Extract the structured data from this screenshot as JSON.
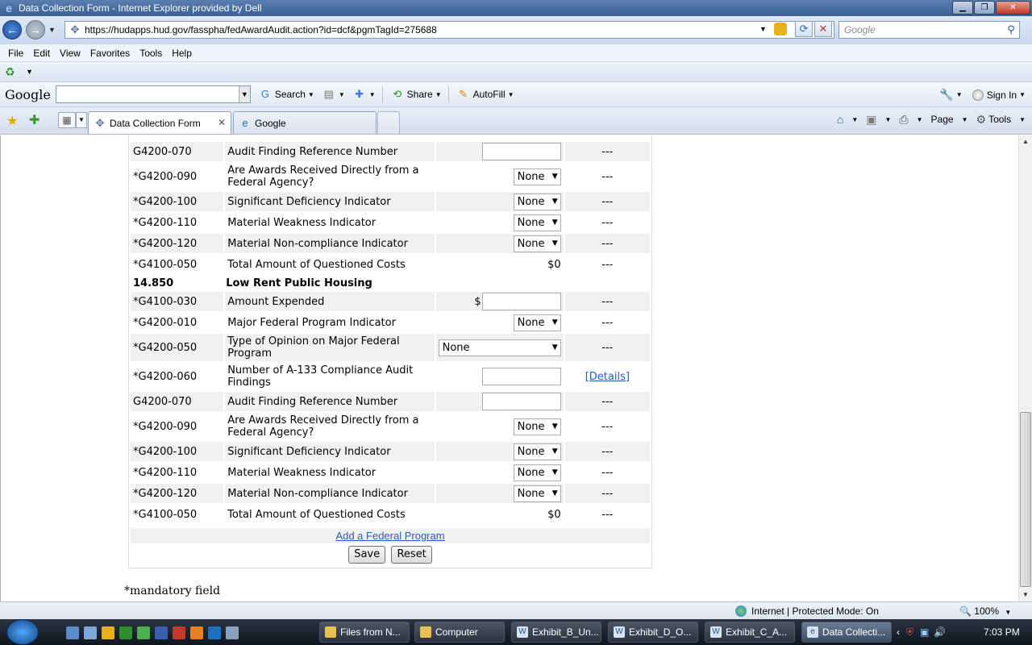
{
  "window": {
    "title": "Data Collection Form - Internet Explorer provided by Dell"
  },
  "address": {
    "url": "https://hudapps.hud.gov/fasspha/fedAwardAudit.action?id=dcf&pgmTagId=275688",
    "search_placeholder": "Google"
  },
  "menu": [
    "File",
    "Edit",
    "View",
    "Favorites",
    "Tools",
    "Help"
  ],
  "google_toolbar": {
    "logo": "Google",
    "search_label": "Search",
    "share_label": "Share",
    "autofill_label": "AutoFill",
    "signin_label": "Sign In"
  },
  "tabs": [
    {
      "label": "Data Collection Form",
      "active": true
    },
    {
      "label": "Google",
      "active": false
    }
  ],
  "command_bar": {
    "page": "Page",
    "tools": "Tools"
  },
  "form": {
    "rows_a": [
      {
        "code": "G4200-070",
        "label": "Audit Finding Reference Number",
        "control": "text",
        "status": "---"
      },
      {
        "code": "*G4200-090",
        "label": "Are Awards Received Directly from a Federal Agency?",
        "control": "select",
        "value": "None",
        "status": "---"
      },
      {
        "code": "*G4200-100",
        "label": "Significant Deficiency Indicator",
        "control": "select",
        "value": "None",
        "status": "---"
      },
      {
        "code": "*G4200-110",
        "label": "Material Weakness Indicator",
        "control": "select",
        "value": "None",
        "status": "---"
      },
      {
        "code": "*G4200-120",
        "label": "Material Non-compliance Indicator",
        "control": "select",
        "value": "None",
        "status": "---"
      },
      {
        "code": "*G4100-050",
        "label": "Total Amount of Questioned Costs",
        "control": "amount",
        "value": "$0",
        "status": "---"
      }
    ],
    "section": {
      "code": "14.850",
      "title": "Low Rent Public Housing"
    },
    "rows_b": [
      {
        "code": "*G4100-030",
        "label": "Amount Expended",
        "control": "money",
        "currency": "$",
        "status": "---"
      },
      {
        "code": "*G4200-010",
        "label": "Major Federal Program Indicator",
        "control": "select",
        "value": "None",
        "status": "---"
      },
      {
        "code": "*G4200-050",
        "label": "Type of Opinion on Major Federal Program",
        "control": "select-wide",
        "value": "None",
        "status": "---"
      },
      {
        "code": "*G4200-060",
        "label": "Number of A-133 Compliance Audit Findings",
        "control": "text",
        "status": "[Details]"
      },
      {
        "code": "G4200-070",
        "label": "Audit Finding Reference Number",
        "control": "text",
        "status": "---"
      },
      {
        "code": "*G4200-090",
        "label": "Are Awards Received Directly from a Federal Agency?",
        "control": "select",
        "value": "None",
        "status": "---"
      },
      {
        "code": "*G4200-100",
        "label": "Significant Deficiency Indicator",
        "control": "select",
        "value": "None",
        "status": "---"
      },
      {
        "code": "*G4200-110",
        "label": "Material Weakness Indicator",
        "control": "select",
        "value": "None",
        "status": "---"
      },
      {
        "code": "*G4200-120",
        "label": "Material Non-compliance Indicator",
        "control": "select",
        "value": "None",
        "status": "---"
      },
      {
        "code": "*G4100-050",
        "label": "Total Amount of Questioned Costs",
        "control": "amount",
        "value": "$0",
        "status": "---"
      }
    ],
    "add_program_link": "Add a Federal Program",
    "save_label": "Save",
    "reset_label": "Reset",
    "mandatory_note": "*mandatory field"
  },
  "status_bar": {
    "zone": "Internet | Protected Mode: On",
    "zoom": "100%"
  },
  "taskbar": {
    "buttons": [
      {
        "label": "Files from N...",
        "active": false
      },
      {
        "label": "Computer",
        "active": false
      },
      {
        "label": "Exhibit_B_Un...",
        "active": false
      },
      {
        "label": "Exhibit_D_O...",
        "active": false
      },
      {
        "label": "Exhibit_C_A...",
        "active": false
      },
      {
        "label": "Data Collecti...",
        "active": true
      }
    ],
    "clock": "7:03 PM"
  }
}
